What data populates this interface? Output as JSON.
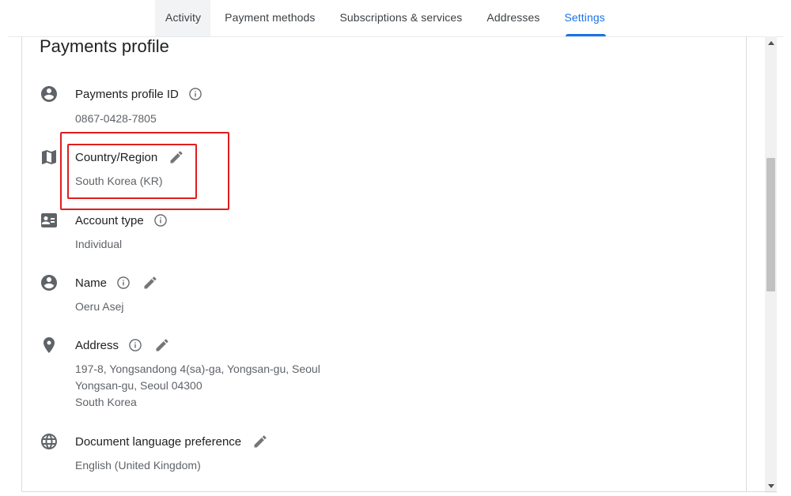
{
  "tabs": [
    {
      "label": "Activity"
    },
    {
      "label": "Payment methods"
    },
    {
      "label": "Subscriptions & services"
    },
    {
      "label": "Addresses"
    },
    {
      "label": "Settings",
      "active": true
    }
  ],
  "card": {
    "title": "Payments profile"
  },
  "fields": {
    "profile_id": {
      "label": "Payments profile ID",
      "value": "0867-0428-7805",
      "icon": "account-circle-icon"
    },
    "country": {
      "label": "Country/Region",
      "value": "South Korea (KR)",
      "icon": "map-icon"
    },
    "account_type": {
      "label": "Account type",
      "value": "Individual",
      "icon": "contact-card-icon"
    },
    "name": {
      "label": "Name",
      "value": "Oeru Asej",
      "icon": "account-circle-icon"
    },
    "address": {
      "label": "Address",
      "lines": [
        "197-8, Yongsandong 4(sa)-ga, Yongsan-gu, Seoul",
        "Yongsan-gu, Seoul 04300",
        "South Korea"
      ],
      "icon": "location-pin-icon"
    },
    "doc_language": {
      "label": "Document language preference",
      "value": "English (United Kingdom)",
      "icon": "globe-icon"
    }
  },
  "colors": {
    "accent": "#1a73e8",
    "highlight": "#e01e1e",
    "icon": "#5f6368"
  }
}
